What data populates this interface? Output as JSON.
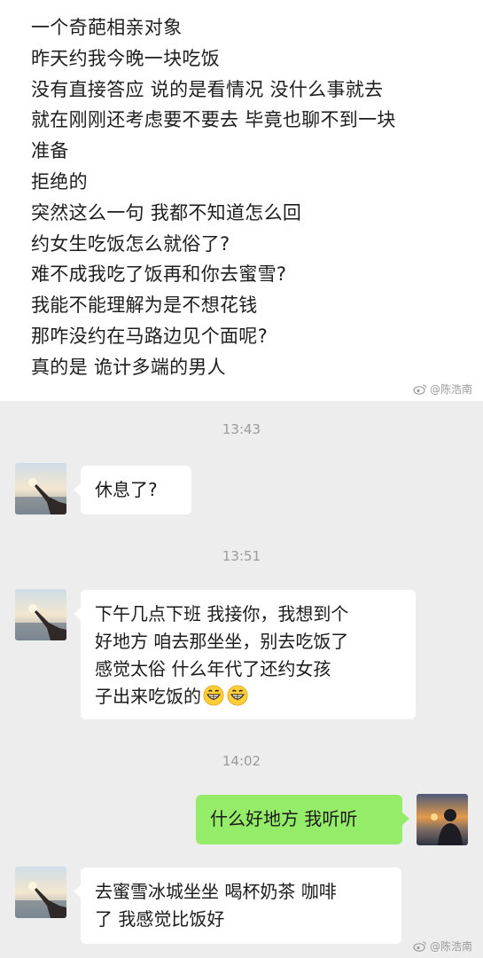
{
  "caption": {
    "lines": [
      "一个奇葩相亲对象",
      "昨天约我今晚一块吃饭",
      "没有直接答应 说的是看情况 没什么事就去",
      "就在刚刚还考虑要不要去 毕竟也聊不到一块",
      "准备",
      "拒绝的",
      "突然这么一句 我都不知道怎么回",
      "约女生吃饭怎么就俗了?",
      "难不成我吃了饭再和你去蜜雪?",
      "我能不能理解为是不想花钱",
      "那咋没约在马路边见个面呢?",
      "真的是 诡计多端的男人"
    ],
    "watermark": "@陈浩南"
  },
  "chat": {
    "messages": [
      {
        "type": "time",
        "text": "13:43"
      },
      {
        "type": "left",
        "lines": [
          "休息了?"
        ]
      },
      {
        "type": "time",
        "text": "13:51"
      },
      {
        "type": "left",
        "lines": [
          "下午几点下班 我接你，我想到个",
          "好地方 咱去那坐坐，别去吃饭了",
          " 感觉太俗 什么年代了还约女孩",
          "子出来吃饭的"
        ],
        "trailing_emoji": "grinning-emoji x2"
      },
      {
        "type": "time",
        "text": "14:02"
      },
      {
        "type": "right",
        "lines": [
          "什么好地方 我听听"
        ]
      },
      {
        "type": "left",
        "lines": [
          "去蜜雪冰城坐坐 喝杯奶茶 咖啡",
          "了 我感觉比饭好"
        ]
      }
    ],
    "watermark": "@陈浩南"
  },
  "colors": {
    "chat_background": "#ededed",
    "incoming_bubble": "#ffffff",
    "outgoing_bubble": "#95ec69",
    "timestamp": "#9b9b9b"
  }
}
